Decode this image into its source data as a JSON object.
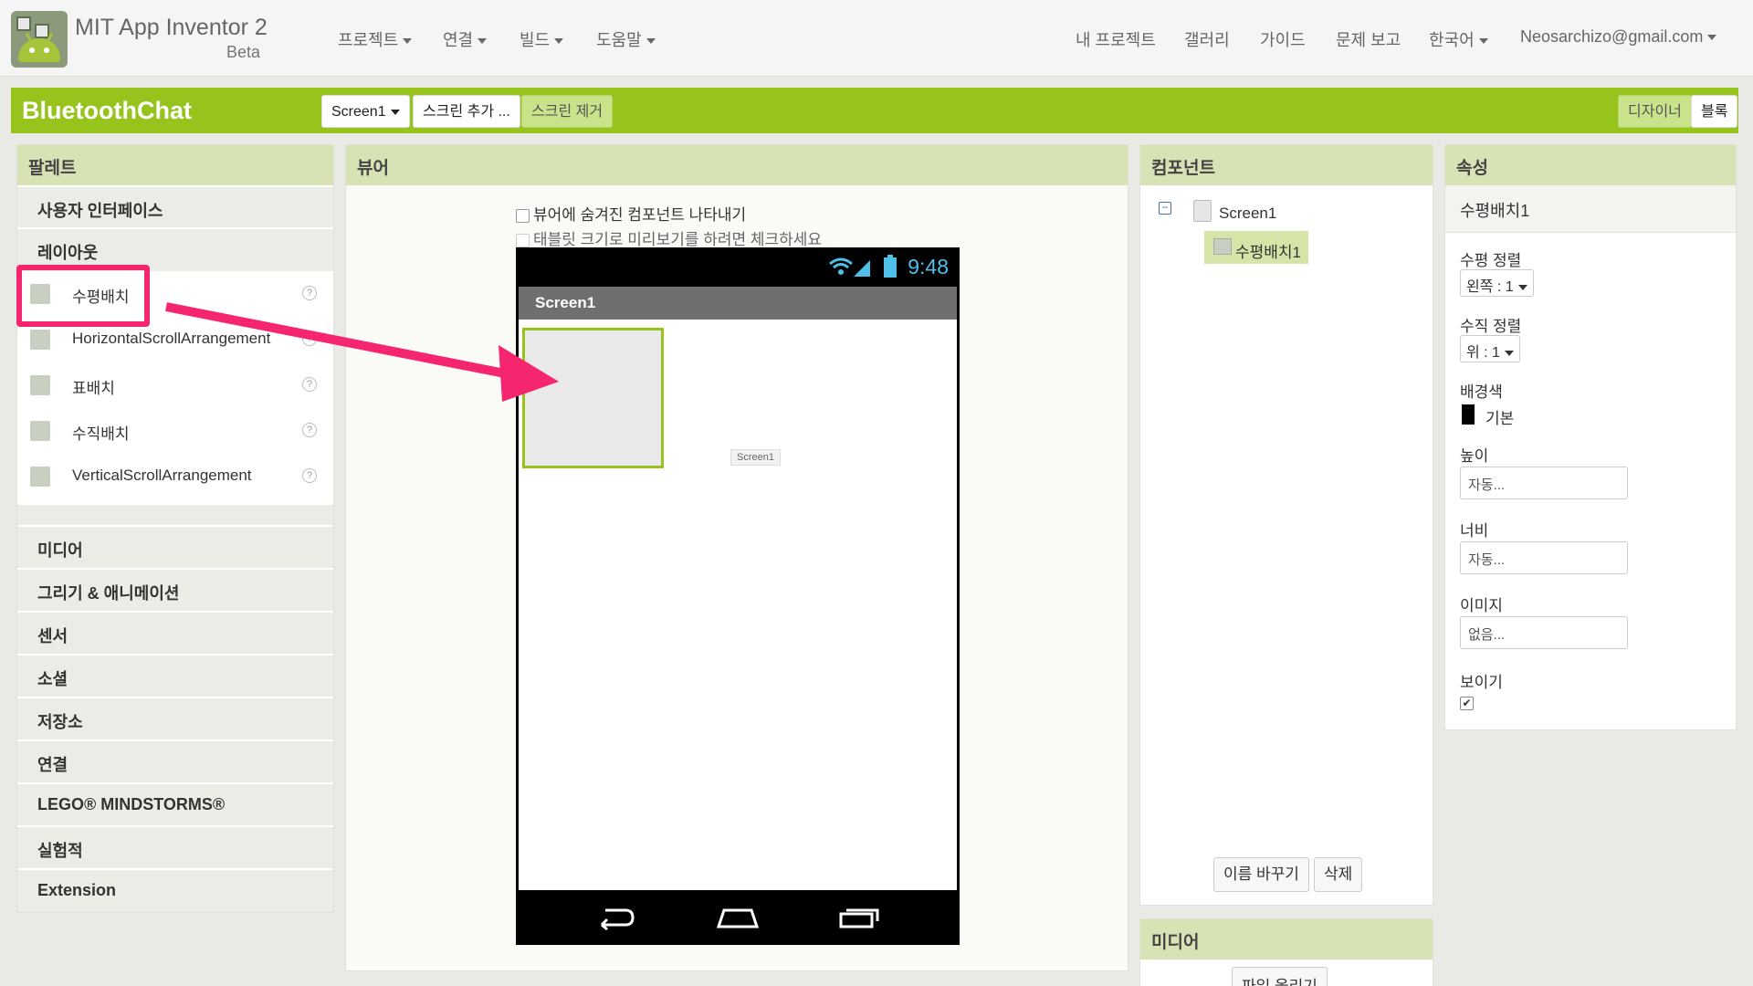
{
  "app": {
    "name": "MIT App Inventor 2",
    "edition": "Beta"
  },
  "topnav": {
    "left": [
      "프로젝트",
      "연결",
      "빌드",
      "도움말"
    ],
    "right": [
      "내 프로젝트",
      "갤러리",
      "가이드",
      "문제 보고",
      "한국어"
    ],
    "user": "Neosarchizo@gmail.com"
  },
  "project": {
    "name": "BluetoothChat",
    "screen_select": "Screen1",
    "add_screen": "스크린 추가 ...",
    "remove_screen": "스크린 제거",
    "designer": "디자이너",
    "blocks": "블록"
  },
  "palette": {
    "title": "팔레트",
    "categories_top": [
      "사용자 인터페이스",
      "레이아웃"
    ],
    "items": [
      "수평배치",
      "HorizontalScrollArrangement",
      "표배치",
      "수직배치",
      "VerticalScrollArrangement"
    ],
    "categories_bottom": [
      "미디어",
      "그리기 & 애니메이션",
      "센서",
      "소셜",
      "저장소",
      "연결",
      "LEGO® MINDSTORMS®",
      "실험적",
      "Extension"
    ]
  },
  "viewer": {
    "title": "뷰어",
    "show_hidden": "뷰어에 숨겨진 컴포넌트 나타내기",
    "tablet_preview": "태블릿 크기로 미리보기를 하려면 체크하세요",
    "clock": "9:48",
    "screen_title": "Screen1",
    "tooltip": "Screen1"
  },
  "components": {
    "title": "컴포넌트",
    "root": "Screen1",
    "child": "수평배치1",
    "rename": "이름 바꾸기",
    "delete": "삭제"
  },
  "media": {
    "title": "미디어",
    "upload": "파일 올리기"
  },
  "properties": {
    "title": "속성",
    "component": "수평배치1",
    "align_h_label": "수평 정렬",
    "align_h_value": "왼쪽 : 1",
    "align_v_label": "수직 정렬",
    "align_v_value": "위 : 1",
    "bg_label": "배경색",
    "bg_value": "기본",
    "height_label": "높이",
    "height_value": "자동...",
    "width_label": "너비",
    "width_value": "자동...",
    "image_label": "이미지",
    "image_value": "없음...",
    "visible_label": "보이기"
  },
  "colors": {
    "accent": "#96c41c",
    "highlight": "#f5266f",
    "clock": "#4fc1e9"
  }
}
